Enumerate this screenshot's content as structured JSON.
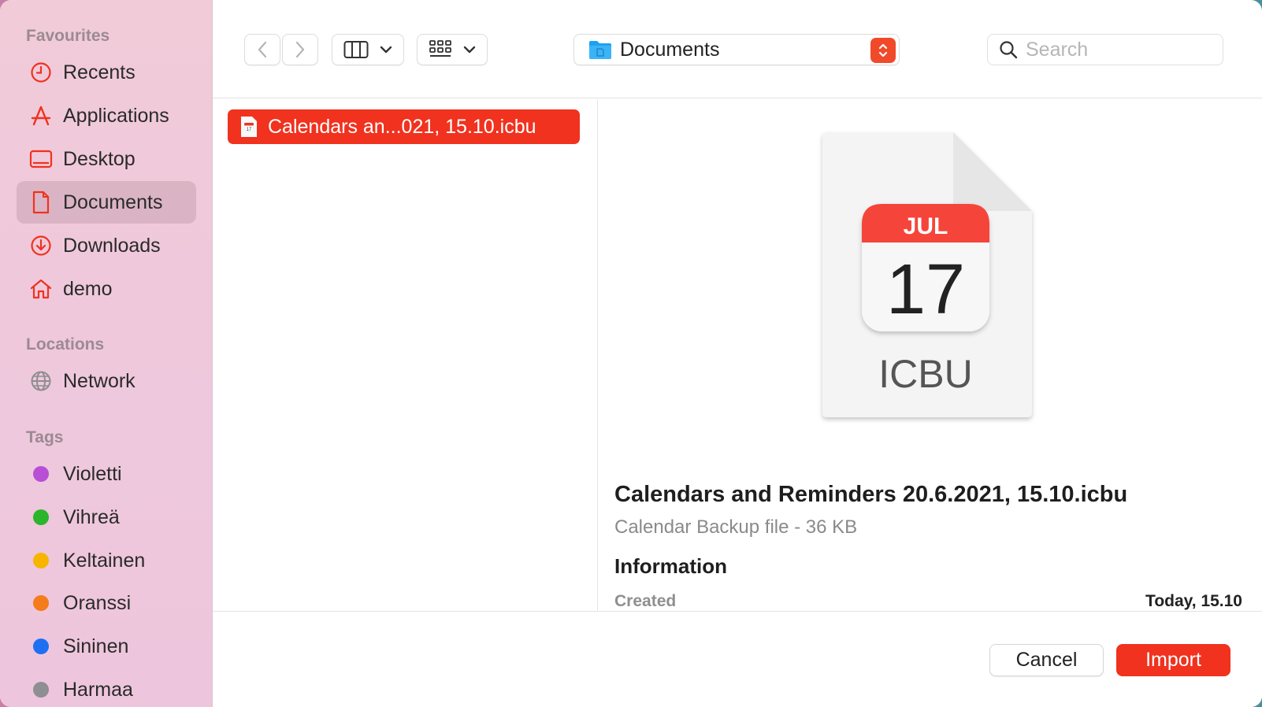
{
  "sidebar": {
    "favourites_heading": "Favourites",
    "favourites": [
      {
        "label": "Recents",
        "icon": "clock-icon"
      },
      {
        "label": "Applications",
        "icon": "applications-icon"
      },
      {
        "label": "Desktop",
        "icon": "desktop-icon"
      },
      {
        "label": "Documents",
        "icon": "document-icon",
        "selected": true
      },
      {
        "label": "Downloads",
        "icon": "download-icon"
      },
      {
        "label": "demo",
        "icon": "home-icon"
      }
    ],
    "locations_heading": "Locations",
    "locations": [
      {
        "label": "Network",
        "icon": "globe-icon"
      }
    ],
    "tags_heading": "Tags",
    "tags": [
      {
        "label": "Violetti",
        "color": "#b84fd6"
      },
      {
        "label": "Vihreä",
        "color": "#2bb52b"
      },
      {
        "label": "Keltainen",
        "color": "#f7b500"
      },
      {
        "label": "Oranssi",
        "color": "#f47c1a"
      },
      {
        "label": "Sininen",
        "color": "#1f6ff2"
      },
      {
        "label": "Harmaa",
        "color": "#8e8e93"
      }
    ]
  },
  "toolbar": {
    "location": "Documents",
    "search_placeholder": "Search"
  },
  "file_list": {
    "selected_file": "Calendars an...021, 15.10.icbu"
  },
  "preview": {
    "icon_month": "JUL",
    "icon_day": "17",
    "icon_ext": "ICBU",
    "title": "Calendars and Reminders 20.6.2021, 15.10.icbu",
    "kind": "Calendar Backup file - 36 KB",
    "info_heading": "Information",
    "created_label": "Created",
    "created_value": "Today, 15.10"
  },
  "buttons": {
    "cancel": "Cancel",
    "import": "Import"
  },
  "colors": {
    "accent": "#f0321f"
  }
}
